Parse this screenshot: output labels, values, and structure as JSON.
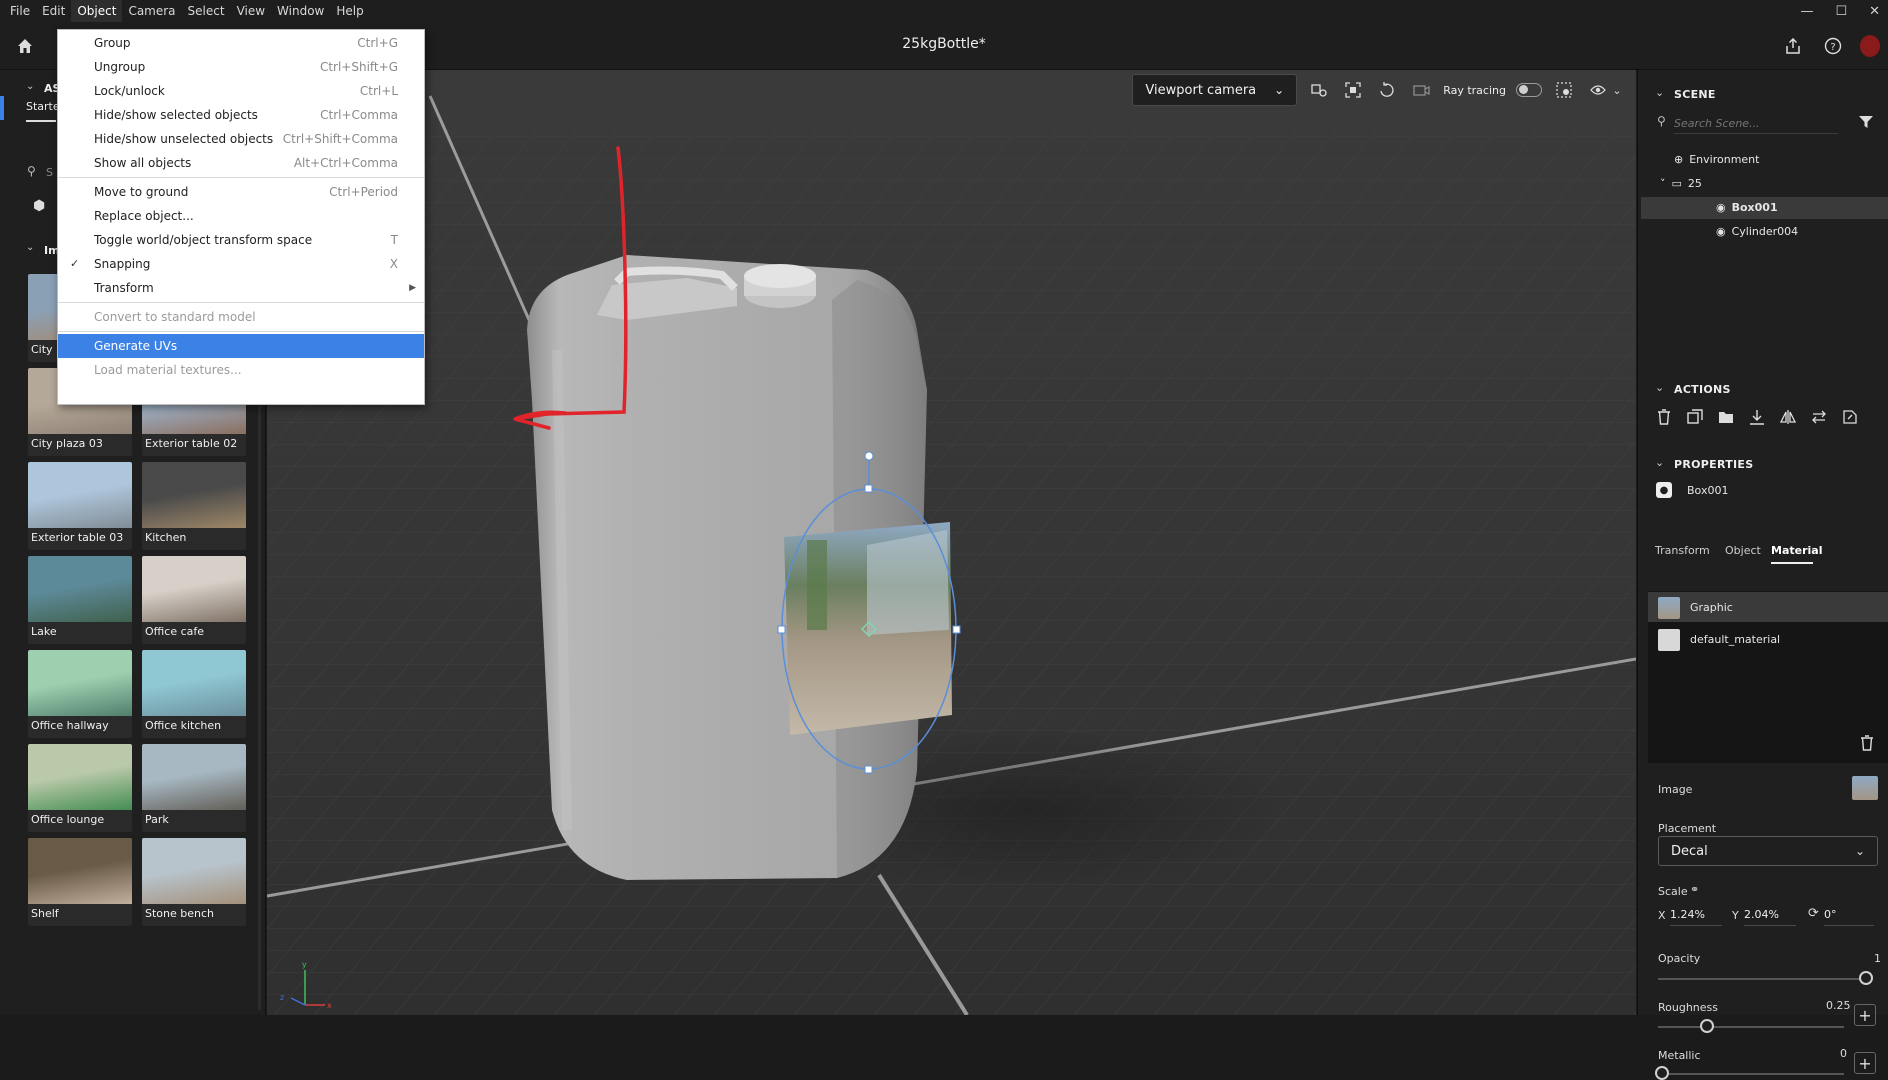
{
  "menubar": {
    "items": [
      "File",
      "Edit",
      "Object",
      "Camera",
      "Select",
      "View",
      "Window",
      "Help"
    ],
    "active_index": 2
  },
  "titlebar": {
    "title": "25kgBottle*"
  },
  "object_menu": {
    "groups": [
      [
        {
          "label": "Group",
          "shortcut": "Ctrl+G"
        },
        {
          "label": "Ungroup",
          "shortcut": "Ctrl+Shift+G"
        },
        {
          "label": "Lock/unlock",
          "shortcut": "Ctrl+L"
        },
        {
          "label": "Hide/show selected objects",
          "shortcut": "Ctrl+Comma"
        },
        {
          "label": "Hide/show unselected objects",
          "shortcut": "Ctrl+Shift+Comma"
        },
        {
          "label": "Show all objects",
          "shortcut": "Alt+Ctrl+Comma"
        }
      ],
      [
        {
          "label": "Move to ground",
          "shortcut": "Ctrl+Period"
        },
        {
          "label": "Replace object...",
          "shortcut": ""
        },
        {
          "label": "Toggle world/object transform space",
          "shortcut": "T"
        },
        {
          "label": "Snapping",
          "shortcut": "X",
          "checked": true
        },
        {
          "label": "Transform",
          "shortcut": "",
          "submenu": true
        }
      ],
      [
        {
          "label": "Convert to standard model",
          "shortcut": "",
          "disabled": true
        }
      ],
      [
        {
          "label": "Generate UVs",
          "shortcut": "",
          "highlighted": true
        },
        {
          "label": "Load material textures...",
          "shortcut": "",
          "disabled": true
        }
      ]
    ]
  },
  "left_panel": {
    "header_partial": "AS",
    "tab_partial": "Starte",
    "search_partial": "S",
    "section_partial": "Im",
    "thumbnails": [
      {
        "label": "City p",
        "colors": [
          "#8aa0b5",
          "#a8876a"
        ]
      },
      {
        "label": "",
        "colors": [
          "#a7a7a7",
          "#6d6d6d"
        ]
      },
      {
        "label": "City plaza 03",
        "colors": [
          "#b4a898",
          "#8d8074"
        ]
      },
      {
        "label": "Exterior table 02",
        "colors": [
          "#9eb2c8",
          "#8a6b5a"
        ]
      },
      {
        "label": "Exterior table 03",
        "colors": [
          "#aec6dc",
          "#7f8a92"
        ]
      },
      {
        "label": "Kitchen",
        "colors": [
          "#4a4a4a",
          "#a28a6a"
        ]
      },
      {
        "label": "Lake",
        "colors": [
          "#5d8a99",
          "#3f5f4a"
        ]
      },
      {
        "label": "Office cafe",
        "colors": [
          "#d6d0c8",
          "#7c6e62"
        ]
      },
      {
        "label": "Office hallway",
        "colors": [
          "#9ed0b0",
          "#4c7c6a"
        ]
      },
      {
        "label": "Office kitchen",
        "colors": [
          "#8fc7d2",
          "#6a8f9b"
        ]
      },
      {
        "label": "Office lounge",
        "colors": [
          "#b9c9a9",
          "#3f8a4f"
        ]
      },
      {
        "label": "Park",
        "colors": [
          "#a7b8c2",
          "#5f5a52"
        ]
      },
      {
        "label": "Shelf",
        "colors": [
          "#6a5a48",
          "#c4b4a0"
        ]
      },
      {
        "label": "Stone bench",
        "colors": [
          "#b8c4cc",
          "#a48e78"
        ]
      }
    ]
  },
  "viewport": {
    "camera_label": "Viewport camera",
    "ray_tracing_label": "Ray tracing",
    "ray_tracing_on": false,
    "axis_labels": {
      "x": "x",
      "y": "y",
      "z": "z"
    }
  },
  "right_panel": {
    "scene": {
      "title": "SCENE",
      "search_placeholder": "Search Scene...",
      "items": [
        {
          "label": "Environment",
          "icon": "globe-icon"
        },
        {
          "label": "25",
          "icon": "folder-icon"
        },
        {
          "label": "Box001",
          "icon": "object-icon",
          "selected": true
        },
        {
          "label": "Cylinder004",
          "icon": "object-icon"
        }
      ]
    },
    "actions": {
      "title": "ACTIONS"
    },
    "properties": {
      "title": "PROPERTIES",
      "object_name": "Box001",
      "tabs": [
        "Transform",
        "Object",
        "Material"
      ],
      "active_tab": 2,
      "materials": [
        {
          "label": "Graphic",
          "selected": true
        },
        {
          "label": "default_material"
        }
      ],
      "image_label": "Image",
      "placement_label": "Placement",
      "placement_value": "Decal",
      "scale_label": "Scale",
      "scale_x_label": "X",
      "scale_x": "1.24%",
      "scale_y_label": "Y",
      "scale_y": "2.04%",
      "rotation": "0°",
      "opacity_label": "Opacity",
      "opacity_value": "1",
      "roughness_label": "Roughness",
      "roughness_value": "0.25",
      "metallic_label": "Metallic",
      "metallic_value": "0"
    }
  },
  "colors": {
    "accent": "#3c82e6",
    "annotation": "#e0242a",
    "panel": "#1f1f1f"
  }
}
